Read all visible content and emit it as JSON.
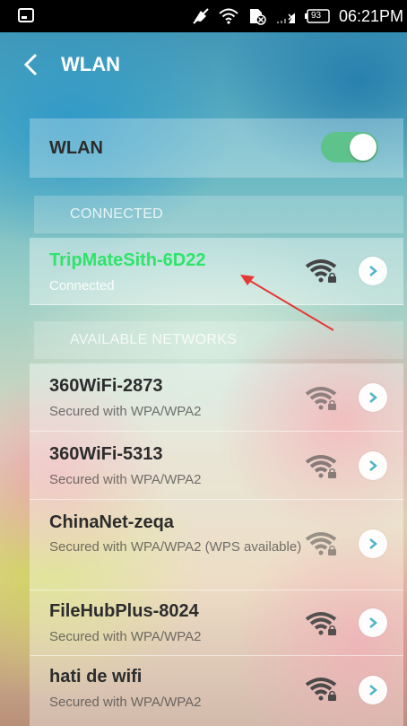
{
  "status_bar": {
    "left_icon": "screenshot-icon",
    "icons": [
      "muted-icon",
      "wifi-icon",
      "no-sim-icon",
      "signal-icon",
      "battery-icon"
    ],
    "battery_level": "93",
    "time": "06:21PM"
  },
  "header": {
    "back_icon": "chevron-left-icon",
    "title": "WLAN"
  },
  "wlan_toggle": {
    "label": "WLAN",
    "enabled": true,
    "color": "#5ec28b"
  },
  "sections": {
    "connected": "CONNECTED",
    "available": "AVAILABLE NETWORKS"
  },
  "connected_network": {
    "name": "TripMateSith-6D22",
    "status": "Connected",
    "name_color": "#2ee46a"
  },
  "networks": [
    {
      "name": "360WiFi-2873",
      "status": "Secured with WPA/WPA2"
    },
    {
      "name": "360WiFi-5313",
      "status": "Secured with WPA/WPA2"
    },
    {
      "name": "ChinaNet-zeqa",
      "status": "Secured with WPA/WPA2 (WPS available)"
    },
    {
      "name": "FileHubPlus-8024",
      "status": "Secured with WPA/WPA2"
    },
    {
      "name": "hati de wifi",
      "status": "Secured with WPA/WPA2"
    }
  ],
  "annotation": {
    "type": "red-arrow",
    "color": "#e53935"
  }
}
